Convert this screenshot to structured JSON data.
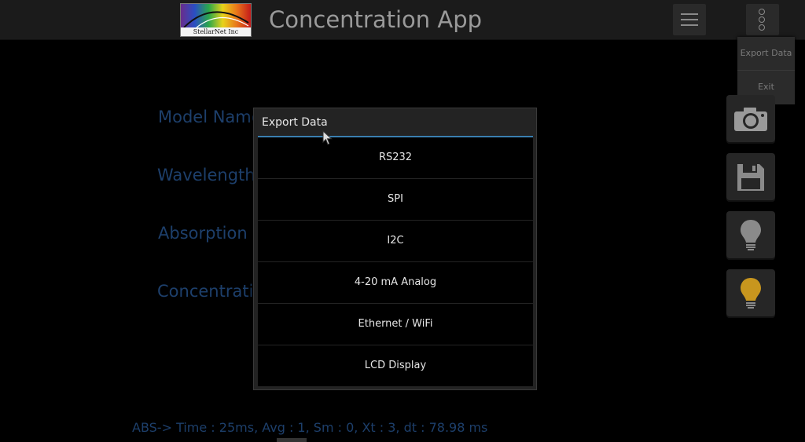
{
  "app": {
    "title": "Concentration App",
    "logo_text": "StellarNet Inc"
  },
  "actionbar": {
    "menu_icon": "hamburger-menu-icon",
    "overflow_icon": "overflow-dots-icon"
  },
  "overflow_menu": {
    "items": [
      {
        "label": "Export Data"
      },
      {
        "label": "Exit"
      }
    ]
  },
  "labels": {
    "model_name": "Model Name",
    "wavelength": "Wavelength",
    "absorption": "Absorption :",
    "concentration": "Concentratio"
  },
  "side_buttons": [
    {
      "icon": "camera-icon"
    },
    {
      "icon": "save-icon"
    },
    {
      "icon": "bulb-off-icon"
    },
    {
      "icon": "bulb-on-icon"
    }
  ],
  "status": {
    "line": "ABS-> Time : 25ms,  Avg : 1,  Sm : 0,  Xt : 3,  dt : 78.98 ms"
  },
  "dialog": {
    "title": "Export Data",
    "items": [
      {
        "label": "RS232"
      },
      {
        "label": "SPI"
      },
      {
        "label": "I2C"
      },
      {
        "label": "4-20 mA Analog"
      },
      {
        "label": "Ethernet / WiFi"
      },
      {
        "label": "LCD Display"
      }
    ]
  },
  "colors": {
    "accent": "#3a7fb0",
    "label_blue": "#1d3f6b",
    "bulb_on": "#c8961e"
  }
}
